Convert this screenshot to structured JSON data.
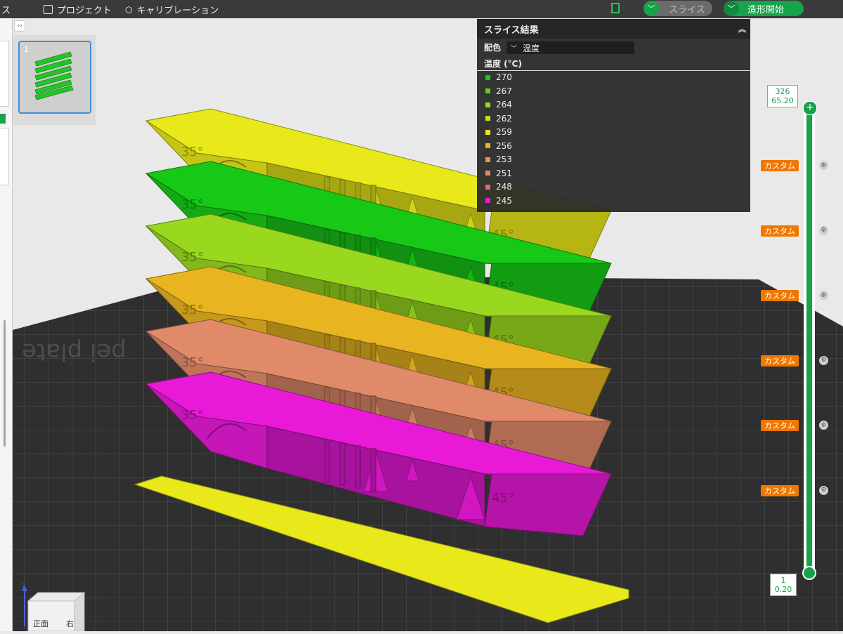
{
  "topbar": {
    "fragment_left": "ス",
    "project_label": "プロジェクト",
    "calibration_label": "キャリブレーション",
    "slice_button": "スライス",
    "print_button": "造形開始"
  },
  "colors": {
    "accent": "#16a34a",
    "badge": "#f07800",
    "legend": [
      "#17c817",
      "#5ed01b",
      "#99d81e",
      "#cfdc1c",
      "#e8e81a",
      "#e8b420",
      "#e89a38",
      "#e08a6a",
      "#e0609a",
      "#e81ad8"
    ]
  },
  "plate": {
    "index": "1",
    "text": "pei plate",
    "cube_front": "正面",
    "cube_right": "右",
    "axis_z": "Z"
  },
  "slice_panel": {
    "title": "スライス結果",
    "color_label": "配色",
    "color_select": "温度",
    "legend_title": "温度 (°C)",
    "legend": [
      "270",
      "267",
      "264",
      "262",
      "259",
      "256",
      "253",
      "251",
      "248",
      "245"
    ]
  },
  "layer_slider": {
    "top_layer": "326",
    "top_height": "65.20",
    "bottom_layer": "1",
    "bottom_height": "0.20",
    "custom_label": "カスタム",
    "marker_count": 6
  },
  "model_labels": {
    "angle_left": "35°",
    "angle_right": "45°"
  },
  "model_layers": [
    "245",
    "251",
    "256",
    "264",
    "270",
    "259"
  ]
}
